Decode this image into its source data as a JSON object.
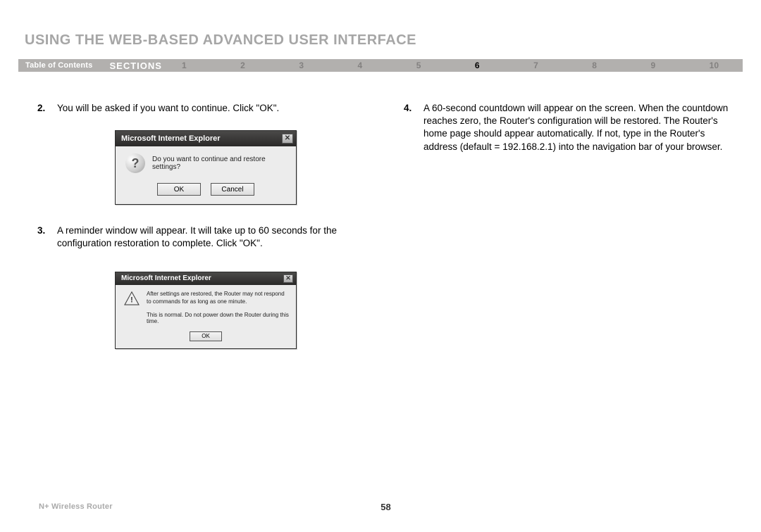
{
  "title": "USING THE WEB-BASED ADVANCED USER INTERFACE",
  "nav": {
    "toc": "Table of Contents",
    "sections": "SECTIONS",
    "items": [
      "1",
      "2",
      "3",
      "4",
      "5",
      "6",
      "7",
      "8",
      "9",
      "10"
    ],
    "active": "6"
  },
  "steps": {
    "s2": {
      "num": "2.",
      "text": "You will be asked if you want to continue. Click \"OK\"."
    },
    "s3": {
      "num": "3.",
      "text": "A reminder window will appear. It will take up to 60 seconds for the configuration restoration to complete. Click \"OK\"."
    },
    "s4": {
      "num": "4.",
      "text": "A 60-second countdown will appear on the screen. When the countdown reaches zero, the Router's configuration will be restored. The Router's home page should appear automatically. If not, type in the Router's address (default = 192.168.2.1) into the navigation bar of your browser."
    }
  },
  "dialog1": {
    "title": "Microsoft Internet Explorer",
    "message": "Do you want to continue and restore settings?",
    "ok": "OK",
    "cancel": "Cancel"
  },
  "dialog2": {
    "title": "Microsoft Internet Explorer",
    "line1": "After settings are restored, the Router may not respond to commands for as long as one minute.",
    "line2": "This is normal. Do not power down the Router during this time.",
    "ok": "OK"
  },
  "footer": {
    "product": "N+ Wireless Router",
    "page": "58"
  }
}
